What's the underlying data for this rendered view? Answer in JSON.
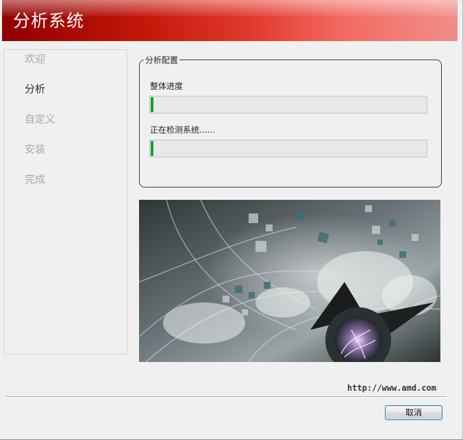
{
  "window": {
    "title": "分析系统"
  },
  "nav": {
    "items": [
      {
        "label": "欢迎",
        "state": "inactive"
      },
      {
        "label": "分析",
        "state": "active"
      },
      {
        "label": "自定义",
        "state": "inactive"
      },
      {
        "label": "安装",
        "state": "inactive"
      },
      {
        "label": "完成",
        "state": "inactive"
      }
    ]
  },
  "config": {
    "legend": "分析配置",
    "overall_label": "整体进度",
    "overall_progress": 0.01,
    "status_label": "正在检测系统......",
    "status_progress": 0.01
  },
  "footer": {
    "url": "http://www.amd.com",
    "cancel_label": "取消"
  },
  "colors": {
    "banner_dark": "#8e0000",
    "banner_light": "#f08e8a",
    "progress_fill": "#16a034"
  }
}
